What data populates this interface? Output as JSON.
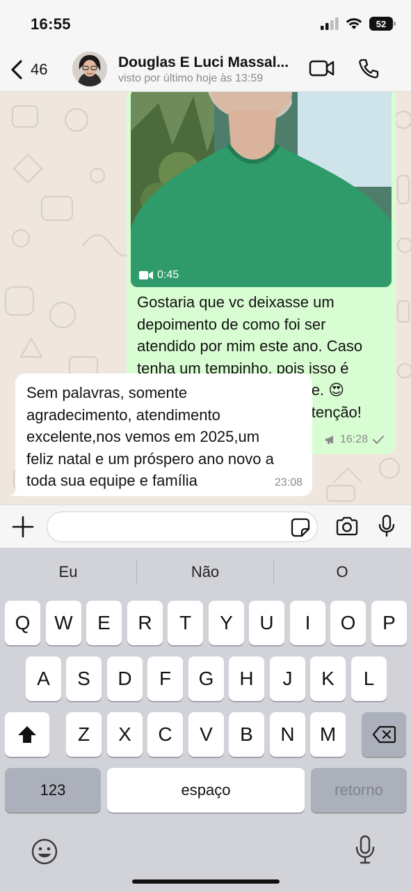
{
  "status_bar": {
    "time": "16:55",
    "battery": "52"
  },
  "header": {
    "back_count": "46",
    "contact_name": "Douglas E Luci Massal...",
    "last_seen": "visto por último hoje às 13:59"
  },
  "messages": {
    "outgoing": {
      "video_duration": "0:45",
      "lines": [
        "Gostaria que vc deixasse um",
        "depoimento de como foi ser",
        "atendido por mim este ano. Caso",
        "tenha um tempinho, pois isso é",
        "muito importante pra gente. 😍",
        "Desde já agradeço pela atenção!",
        "🩵"
      ],
      "time": "16:28",
      "status_icon": "single-check-icon"
    },
    "incoming": {
      "lines": [
        "Sem palavras, somente",
        "agradecimento, atendimento",
        "excelente,nos vemos em 2025,um",
        "feliz natal e um próspero ano novo a",
        "toda sua equipe e família"
      ],
      "time": "23:08"
    }
  },
  "composer": {
    "placeholder": ""
  },
  "keyboard": {
    "suggestions": [
      "Eu",
      "Não",
      "O"
    ],
    "rows": [
      [
        "Q",
        "W",
        "E",
        "R",
        "T",
        "Y",
        "U",
        "I",
        "O",
        "P"
      ],
      [
        "A",
        "S",
        "D",
        "F",
        "G",
        "H",
        "J",
        "K",
        "L"
      ],
      [
        "Z",
        "X",
        "C",
        "V",
        "B",
        "N",
        "M"
      ]
    ],
    "numbers_label": "123",
    "space_label": "espaço",
    "return_label": "retorno"
  },
  "colors": {
    "outgoing_bubble": "#d9fdd3",
    "incoming_bubble": "#ffffff",
    "chat_background": "#efe7de",
    "keyboard_background": "#d1d3d9"
  }
}
